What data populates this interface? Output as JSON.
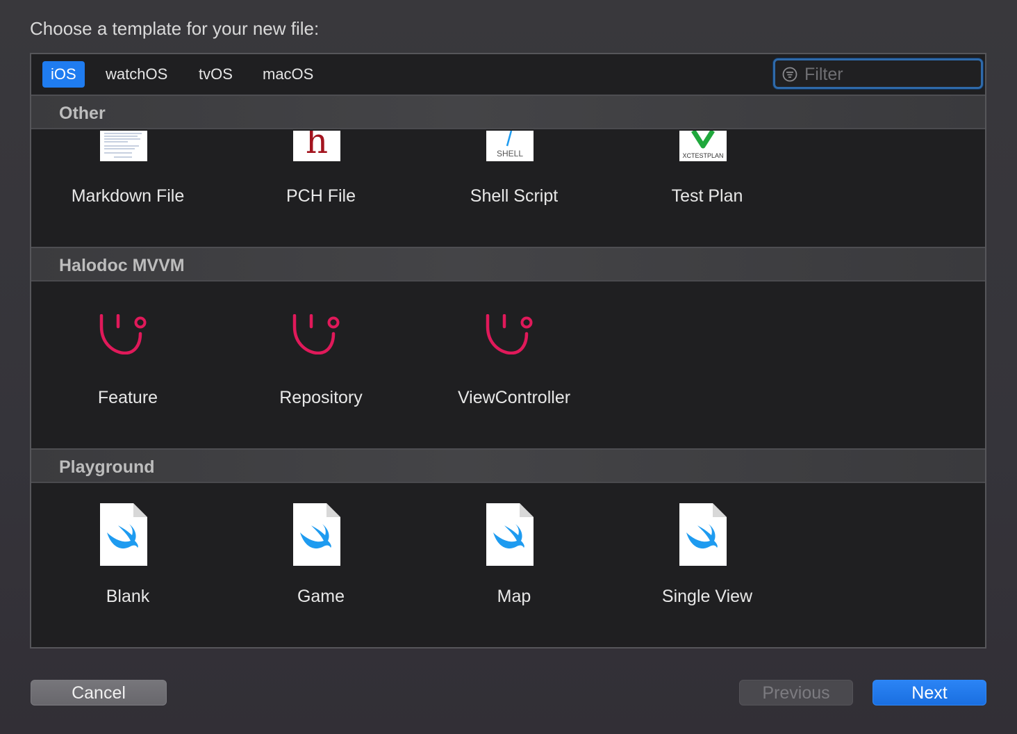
{
  "dialog": {
    "prompt": "Choose a template for your new file:"
  },
  "tabs": [
    {
      "label": "iOS",
      "active": true
    },
    {
      "label": "watchOS",
      "active": false
    },
    {
      "label": "tvOS",
      "active": false
    },
    {
      "label": "macOS",
      "active": false
    }
  ],
  "filter": {
    "placeholder": "Filter",
    "value": "",
    "icon": "filter-icon"
  },
  "sections": [
    {
      "title": "Other",
      "items": [
        {
          "label": "Markdown File",
          "icon": "markdown-file-icon"
        },
        {
          "label": "PCH File",
          "icon": "pch-file-icon",
          "glyph": "h"
        },
        {
          "label": "Shell Script",
          "icon": "shell-script-icon",
          "glyph": "SHELL"
        },
        {
          "label": "Test Plan",
          "icon": "test-plan-icon",
          "glyph": "XCTESTPLAN"
        }
      ]
    },
    {
      "title": "Halodoc MVVM",
      "items": [
        {
          "label": "Feature",
          "icon": "stethoscope-icon"
        },
        {
          "label": "Repository",
          "icon": "stethoscope-icon"
        },
        {
          "label": "ViewController",
          "icon": "stethoscope-icon"
        }
      ]
    },
    {
      "title": "Playground",
      "items": [
        {
          "label": "Blank",
          "icon": "swift-file-icon"
        },
        {
          "label": "Game",
          "icon": "swift-file-icon"
        },
        {
          "label": "Map",
          "icon": "swift-file-icon"
        },
        {
          "label": "Single View",
          "icon": "swift-file-icon"
        }
      ]
    }
  ],
  "buttons": {
    "cancel": "Cancel",
    "previous": "Previous",
    "next": "Next"
  },
  "colors": {
    "accent": "#1f7cf0",
    "halodoc": "#e0195a",
    "swift": "#1e9bf0",
    "testplan": "#1fa83c"
  }
}
